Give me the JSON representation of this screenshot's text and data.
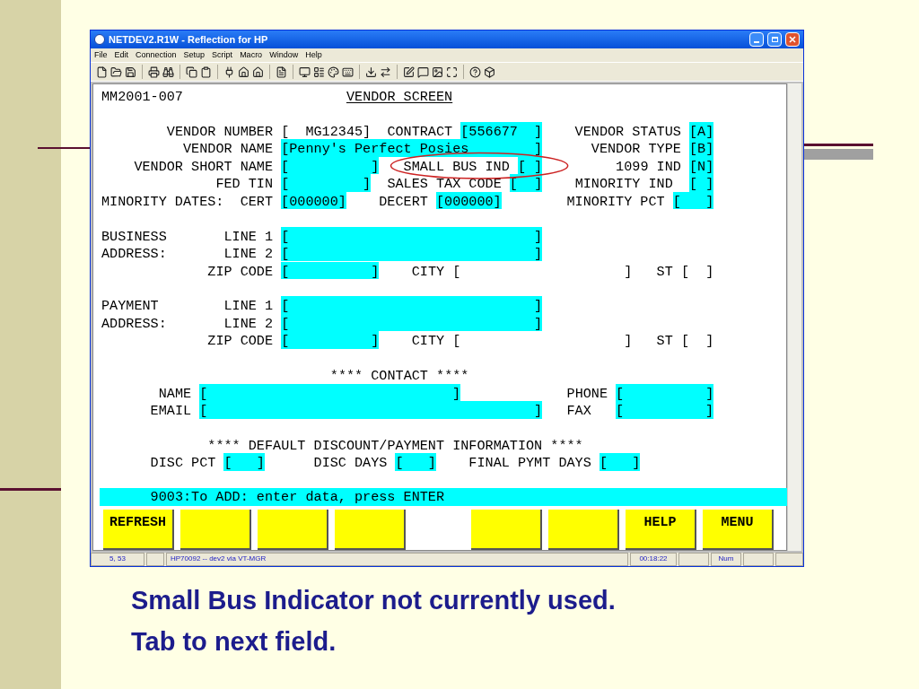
{
  "window": {
    "title": "NETDEV2.R1W - Reflection for HP"
  },
  "menu": [
    "File",
    "Edit",
    "Connection",
    "Setup",
    "Script",
    "Macro",
    "Window",
    "Help"
  ],
  "screen": {
    "rows": [
      {
        "segments": [
          {
            "kind": "label",
            "text": "MM2001-007"
          },
          {
            "kind": "heading",
            "text": "VENDOR SCREEN"
          }
        ]
      },
      {
        "segments": [
          {
            "kind": "label",
            "text": "VENDOR NUMBER"
          },
          {
            "kind": "input",
            "text": "[  MG12345]"
          },
          {
            "kind": "label",
            "text": "CONTRACT"
          },
          {
            "kind": "field",
            "text": "[556677  ]"
          },
          {
            "kind": "label",
            "text": "VENDOR STATUS"
          },
          {
            "kind": "field",
            "text": "[A]"
          }
        ]
      },
      {
        "segments": [
          {
            "kind": "label",
            "text": "VENDOR NAME"
          },
          {
            "kind": "field",
            "text": "[Penny's Perfect Posies        ]"
          },
          {
            "kind": "label",
            "text": "VENDOR TYPE"
          },
          {
            "kind": "field",
            "text": "[B]"
          }
        ]
      },
      {
        "segments": [
          {
            "kind": "label",
            "text": "VENDOR SHORT NAME"
          },
          {
            "kind": "field",
            "text": "[          ]"
          },
          {
            "kind": "label",
            "text": "SMALL BUS IND"
          },
          {
            "kind": "field",
            "text": "[ ]"
          },
          {
            "kind": "label",
            "text": "1099 IND"
          },
          {
            "kind": "field",
            "text": "[N]"
          }
        ]
      },
      {
        "segments": [
          {
            "kind": "label",
            "text": "FED TIN"
          },
          {
            "kind": "field",
            "text": "[         ]"
          },
          {
            "kind": "label",
            "text": "SALES TAX CODE"
          },
          {
            "kind": "field",
            "text": "[  ]"
          },
          {
            "kind": "label",
            "text": "MINORITY IND"
          },
          {
            "kind": "field",
            "text": "[ ]"
          }
        ]
      },
      {
        "segments": [
          {
            "kind": "label",
            "text": "MINORITY DATES:"
          },
          {
            "kind": "label",
            "text": "CERT"
          },
          {
            "kind": "field",
            "text": "[000000]"
          },
          {
            "kind": "label",
            "text": "DECERT"
          },
          {
            "kind": "field",
            "text": "[000000]"
          },
          {
            "kind": "label",
            "text": "MINORITY PCT"
          },
          {
            "kind": "field",
            "text": "[   ]"
          }
        ]
      },
      {
        "segments": [
          {
            "kind": "label",
            "text": "BUSINESS"
          },
          {
            "kind": "label",
            "text": "LINE 1"
          },
          {
            "kind": "field",
            "text": "[                              ]"
          }
        ]
      },
      {
        "segments": [
          {
            "kind": "label",
            "text": "ADDRESS:"
          },
          {
            "kind": "label",
            "text": "LINE 2"
          },
          {
            "kind": "field",
            "text": "[                              ]"
          }
        ]
      },
      {
        "segments": [
          {
            "kind": "label",
            "text": "ZIP CODE"
          },
          {
            "kind": "field",
            "text": "[          ]"
          },
          {
            "kind": "label",
            "text": "CITY"
          },
          {
            "kind": "input",
            "text": "[                    ]"
          },
          {
            "kind": "label",
            "text": "ST"
          },
          {
            "kind": "input",
            "text": "[  ]"
          }
        ]
      },
      {
        "segments": [
          {
            "kind": "label",
            "text": "PAYMENT"
          },
          {
            "kind": "label",
            "text": "LINE 1"
          },
          {
            "kind": "field",
            "text": "[                              ]"
          }
        ]
      },
      {
        "segments": [
          {
            "kind": "label",
            "text": "ADDRESS:"
          },
          {
            "kind": "label",
            "text": "LINE 2"
          },
          {
            "kind": "field",
            "text": "[                              ]"
          }
        ]
      },
      {
        "segments": [
          {
            "kind": "label",
            "text": "ZIP CODE"
          },
          {
            "kind": "field",
            "text": "[          ]"
          },
          {
            "kind": "label",
            "text": "CITY"
          },
          {
            "kind": "input",
            "text": "[                    ]"
          },
          {
            "kind": "label",
            "text": "ST"
          },
          {
            "kind": "input",
            "text": "[  ]"
          }
        ]
      },
      {
        "segments": [
          {
            "kind": "label",
            "text": "**** CONTACT ****"
          }
        ]
      },
      {
        "segments": [
          {
            "kind": "label",
            "text": "NAME"
          },
          {
            "kind": "field",
            "text": "[                              ]"
          },
          {
            "kind": "label",
            "text": "PHONE"
          },
          {
            "kind": "field",
            "text": "[          ]"
          }
        ]
      },
      {
        "segments": [
          {
            "kind": "label",
            "text": "EMAIL"
          },
          {
            "kind": "field",
            "text": "[                                        ]"
          },
          {
            "kind": "label",
            "text": "FAX"
          },
          {
            "kind": "field",
            "text": "[          ]"
          }
        ]
      },
      {
        "segments": [
          {
            "kind": "label",
            "text": "**** DEFAULT DISCOUNT/PAYMENT INFORMATION ****"
          }
        ]
      },
      {
        "segments": [
          {
            "kind": "label",
            "text": "DISC PCT"
          },
          {
            "kind": "field",
            "text": "[   ]"
          },
          {
            "kind": "label",
            "text": "DISC DAYS"
          },
          {
            "kind": "field",
            "text": "[   ]"
          },
          {
            "kind": "label",
            "text": "FINAL PYMT DAYS"
          },
          {
            "kind": "field",
            "text": "[   ]"
          }
        ]
      }
    ],
    "message": "9003:To ADD: enter data, press ENTER"
  },
  "function_keys": {
    "f1": "REFRESH",
    "f7": "HELP",
    "f8": "MENU"
  },
  "status_bar": {
    "position": "5, 53",
    "session": "HP70092 -- dev2 via VT-MGR",
    "time": "00:18:22",
    "keyboard": "Num"
  },
  "caption": [
    "Small Bus Indicator not currently used.",
    "Tab to next field."
  ]
}
